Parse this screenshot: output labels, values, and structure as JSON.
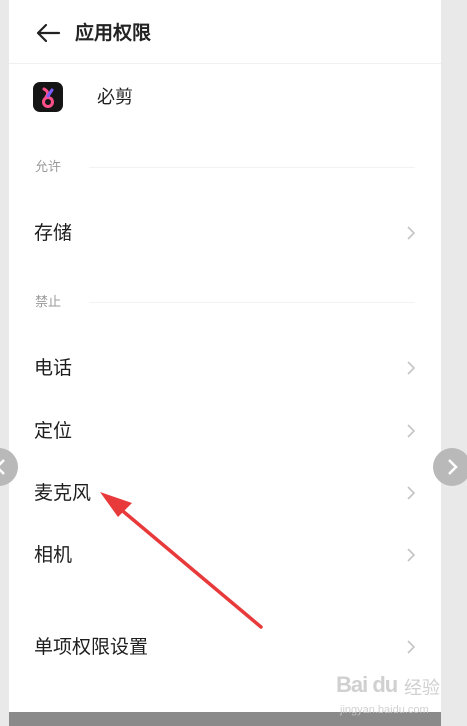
{
  "header": {
    "title": "应用权限",
    "back_icon": "arrow-left-icon"
  },
  "app": {
    "name": "必剪",
    "icon": "bijian-app-icon"
  },
  "allowed": {
    "label": "允许",
    "items": [
      {
        "label": "存储"
      }
    ]
  },
  "denied": {
    "label": "禁止",
    "items": [
      {
        "label": "电话"
      },
      {
        "label": "定位"
      },
      {
        "label": "麦克风"
      },
      {
        "label": "相机"
      }
    ]
  },
  "single_permission": {
    "label": "单项权限设置"
  },
  "chevron_icon": "chevron-right-icon",
  "watermark": {
    "logo": "Bai du",
    "text": "经验",
    "url": "jingyan.baidu.com"
  },
  "colors": {
    "annotation_arrow": "#e83a3a",
    "app_icon_bg": "#151515",
    "app_icon_accent": "#ff4f8b"
  }
}
